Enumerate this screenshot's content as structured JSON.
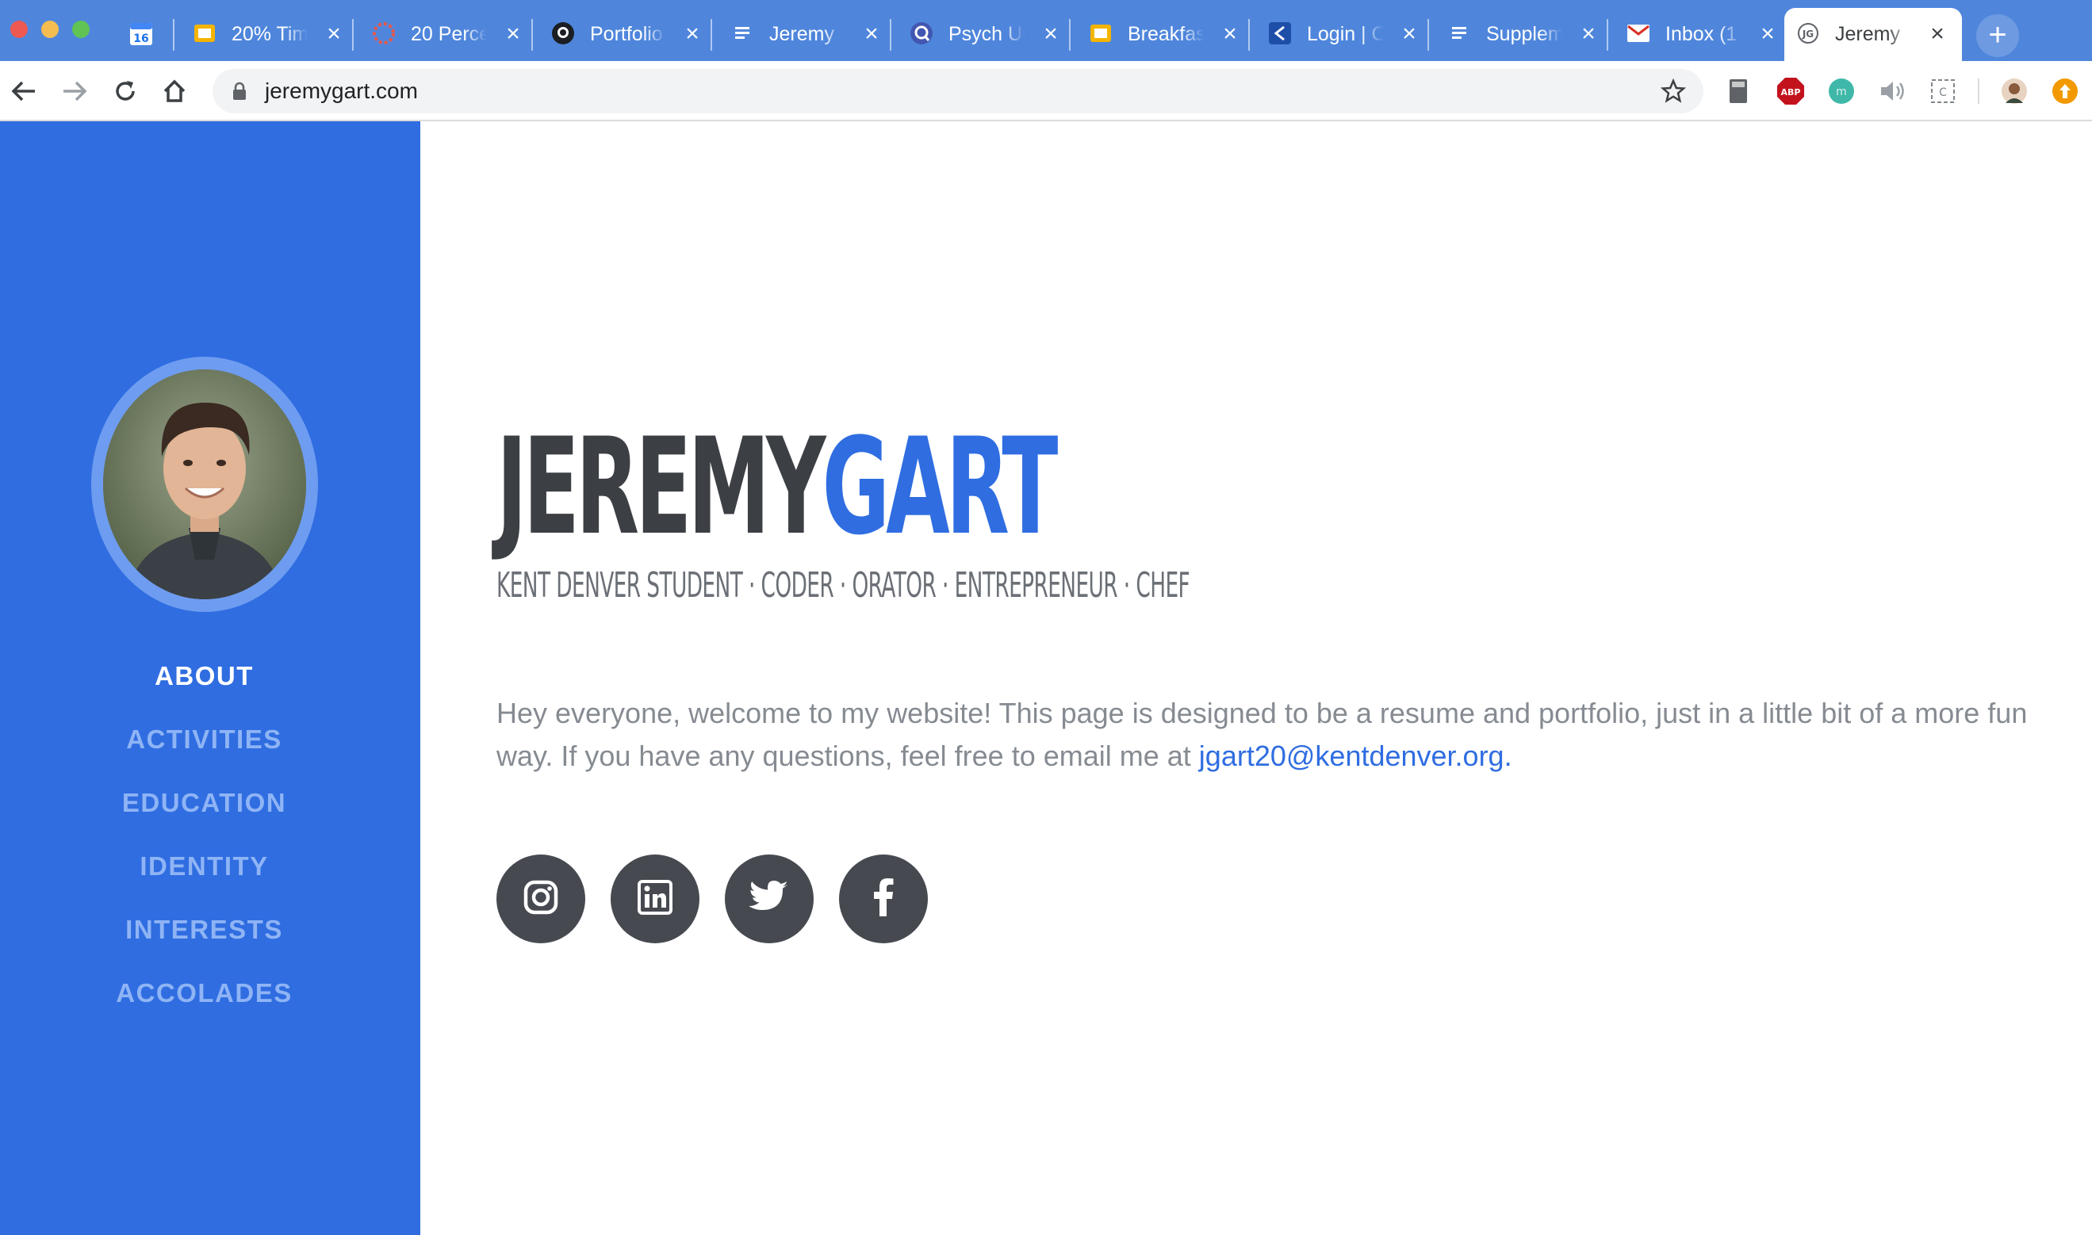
{
  "browser": {
    "tabs": [
      {
        "title": "",
        "icon": "calendar-icon"
      },
      {
        "title": "20% Tim",
        "icon": "slides-icon"
      },
      {
        "title": "20 Perce",
        "icon": "wheel-icon"
      },
      {
        "title": "Portfolio",
        "icon": "github-icon"
      },
      {
        "title": "Jeremy",
        "icon": "docs-icon"
      },
      {
        "title": "Psych Ur",
        "icon": "quizlet-icon"
      },
      {
        "title": "Breakfas",
        "icon": "slides-icon"
      },
      {
        "title": "Login | C",
        "icon": "login-icon"
      },
      {
        "title": "Supplem",
        "icon": "docs-icon"
      },
      {
        "title": "Inbox (1",
        "icon": "gmail-icon"
      },
      {
        "title": "Jeremy",
        "icon": "site-icon"
      }
    ],
    "calendar_day": "16",
    "close_glyph": "×",
    "new_tab_glyph": "+",
    "url": "jeremygart.com"
  },
  "site": {
    "first_name": "JEREMY",
    "last_name": "GART",
    "subheading": "KENT DENVER STUDENT · CODER · ORATOR · ENTREPRENEUR · CHEF",
    "intro_text": "Hey everyone, welcome to my website! This page is designed to be a resume and portfolio, just in a little bit of a more fun way. If you have any questions, feel free to email me at ",
    "email": "jgart20@kentdenver.org",
    "email_suffix": ".",
    "nav": [
      {
        "label": "ABOUT",
        "active": true
      },
      {
        "label": "ACTIVITIES",
        "active": false
      },
      {
        "label": "EDUCATION",
        "active": false
      },
      {
        "label": "IDENTITY",
        "active": false
      },
      {
        "label": "INTERESTS",
        "active": false
      },
      {
        "label": "ACCOLADES",
        "active": false
      }
    ],
    "social": [
      "instagram-icon",
      "linkedin-icon",
      "twitter-icon",
      "facebook-icon"
    ]
  },
  "colors": {
    "brand_blue": "#2f6de1",
    "dark_text": "#3c3f44",
    "tab_bar": "#4f86dc"
  }
}
